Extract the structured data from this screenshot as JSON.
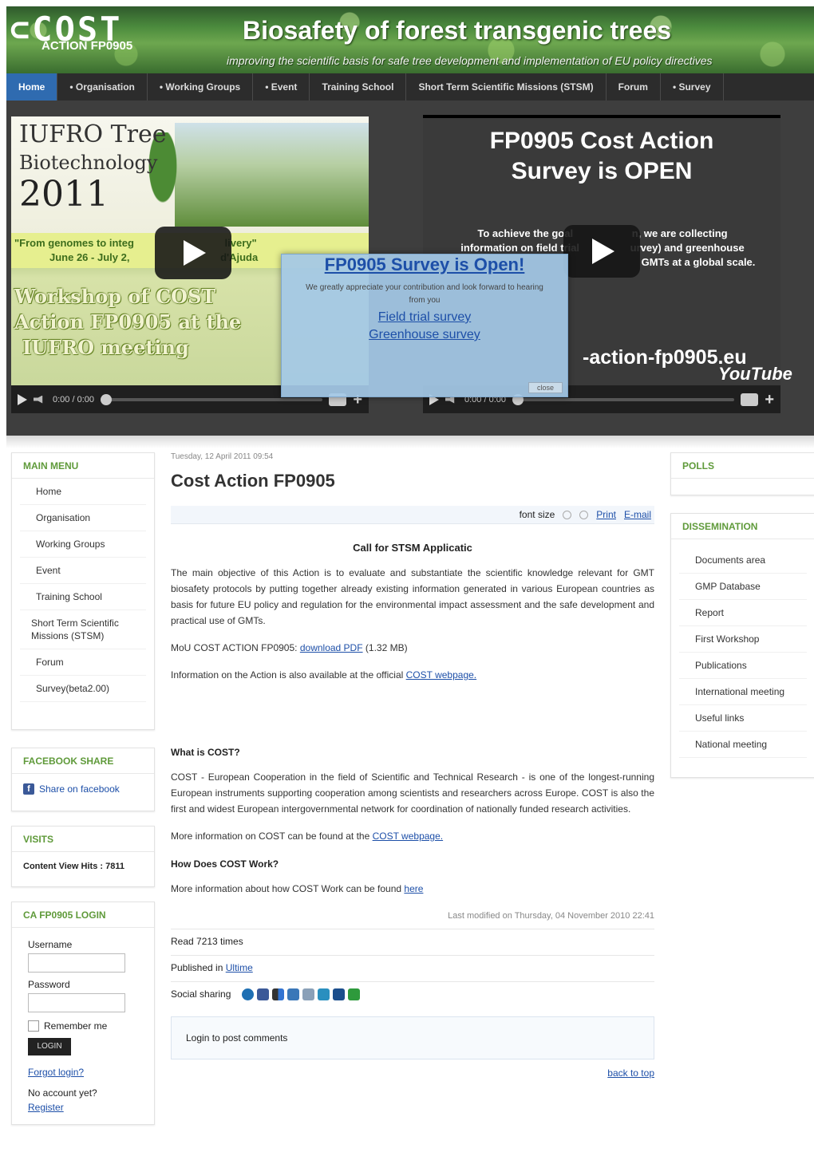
{
  "header": {
    "logo": "⊂COST",
    "action_code": "ACTION FP0905",
    "title": "Biosafety of forest transgenic trees",
    "subtitle": "improving the scientific basis for safe tree development and implementation of EU policy directives"
  },
  "nav": {
    "items": [
      "Home",
      "• Organisation",
      "• Working Groups",
      "• Event",
      "Training School",
      "Short Term Scientific Missions (STSM)",
      "Forum",
      "• Survey"
    ]
  },
  "video_left": {
    "title_line1": "IUFRO Tree",
    "title_line2": "Biotechnology",
    "year": "2011",
    "quote_line1": "\"From genomes to integ",
    "quote_line1b": "livery\"",
    "quote_line2": "June 26 - July 2,",
    "quote_line2b": "d'Ajuda",
    "workshop_line1": "Workshop of COST",
    "workshop_line2": "Action FP0905 at the",
    "workshop_line3": "IUFRO meeting",
    "time": "0:00 / 0:00"
  },
  "video_right": {
    "headline_line1": "FP0905 Cost Action",
    "headline_line2": "Survey is OPEN",
    "body_left": "To achieve the goal",
    "body_right": "n, we are collecting",
    "body2_left": "information on field trial",
    "body2_right": "urvey) and greenhouse",
    "body3": "GMTs at a global scale.",
    "url": "-action-fp0905.eu",
    "youtube": "YouTube",
    "time": "0:00 / 0:00"
  },
  "popup": {
    "title": "FP0905 Survey is Open!",
    "text": "We greatly appreciate your contribution and look forward to hearing from you",
    "link1": "Field trial survey",
    "link2": "Greenhouse survey",
    "close": "close"
  },
  "main_menu": {
    "title": "MAIN MENU",
    "items": [
      "Home",
      "Organisation",
      "Working Groups",
      "Event",
      "Training School",
      "Short Term Scientific Missions (STSM)",
      "Forum",
      "Survey(beta2.00)"
    ]
  },
  "facebook": {
    "title": "FACEBOOK SHARE",
    "link": "Share on facebook"
  },
  "visits": {
    "title": "VISITS",
    "label": "Content View Hits : 7811"
  },
  "login": {
    "title": "CA FP0905 LOGIN",
    "username_label": "Username",
    "password_label": "Password",
    "remember": "Remember me",
    "button": "LOGIN",
    "forgot": "Forgot login?",
    "no_account": "No account yet?",
    "register": "Register"
  },
  "polls": {
    "title": "POLLS"
  },
  "dissemination": {
    "title": "DISSEMINATION",
    "items": [
      "Documents area",
      "GMP Database",
      "Report",
      "First Workshop",
      "Publications",
      "International meeting",
      "Useful links",
      "National meeting"
    ]
  },
  "article": {
    "date": "Tuesday, 12 April 2011 09:54",
    "title": "Cost Action FP0905",
    "font_size_label": "font size",
    "print": "Print",
    "email": "E-mail",
    "call": "Call for STSM Applicatic",
    "p1": "The main objective of this Action is to evaluate and substantiate the scientific knowledge relevant for GMT biosafety protocols by putting together already existing information generated in various European countries as basis for future EU policy and regulation for the environmental impact assessment and the safe development and practical use of GMTs.",
    "mou_prefix": "MoU COST ACTION FP0905:",
    "mou_link": "download PDF",
    "mou_size": "(1.32 MB)",
    "info_prefix": "Information on the Action is also available at the official",
    "info_link": "COST webpage.",
    "what_heading": "What is COST?",
    "p2": "COST - European Cooperation in the field of Scientific and Technical Research - is one of the longest-running European instruments supporting cooperation among scientists and researchers across Europe. COST is also the first and widest European intergovernmental network for coordination of nationally funded research activities.",
    "more_prefix": "More information on COST can be found at the",
    "more_link": "COST webpage.",
    "how_heading": "How Does COST Work?",
    "how_prefix": "More information about how COST Work can be found",
    "how_link": "here",
    "modified": "Last modified on Thursday, 04 November 2010 22:41",
    "read": "Read 7213 times",
    "published_prefix": "Published in",
    "published_link": "Ultime",
    "social_label": "Social sharing",
    "comment": "Login to post comments",
    "back_to_top": "back to top"
  }
}
